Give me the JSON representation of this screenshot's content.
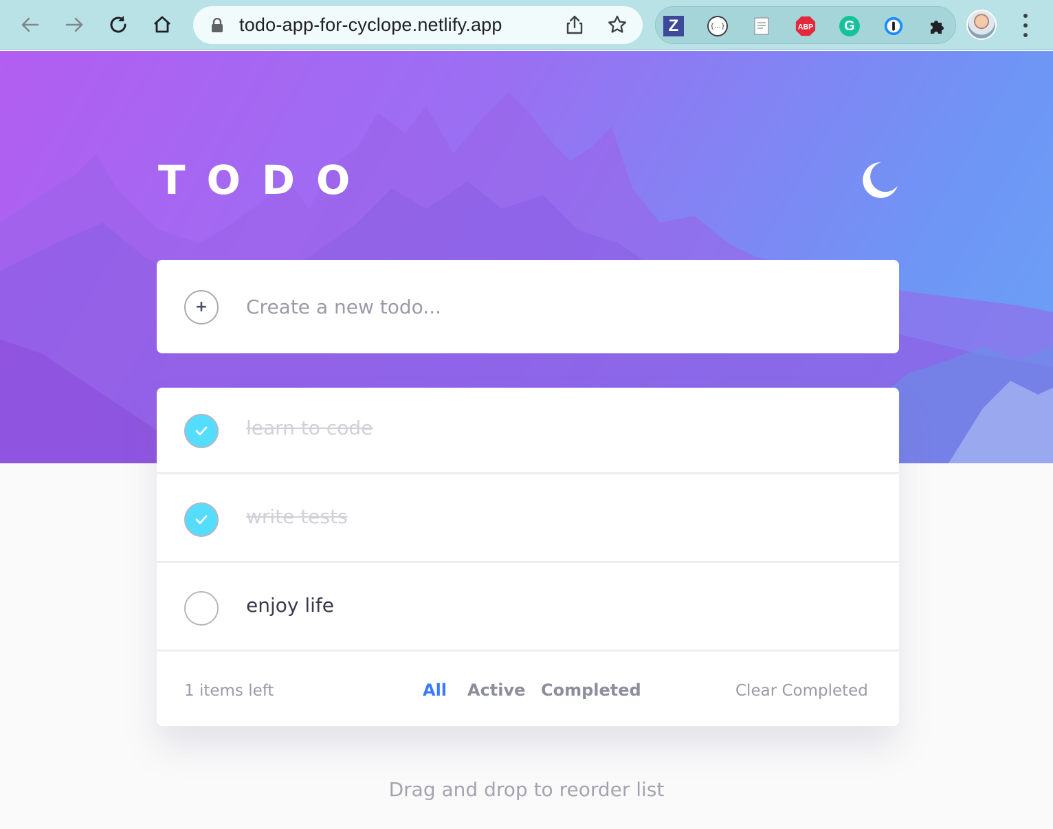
{
  "browser": {
    "url": "todo-app-for-cyclope.netlify.app",
    "extensions": [
      "zotero-icon",
      "json-viewer-icon",
      "page-icon",
      "adblock-plus-icon",
      "grammarly-icon",
      "1password-icon",
      "puzzle-icon"
    ],
    "ext_labels": {
      "zotero": "Z",
      "json": "{...}",
      "abp": "ABP",
      "grammarly": "G"
    },
    "colors": {
      "chrome_bg": "#b8e2e5",
      "abp": "#e2283a",
      "grammarly": "#15c39a",
      "onepassword": "#1a8cff",
      "zotero": "#3d4a9a"
    }
  },
  "app": {
    "title": "TODO",
    "theme_toggle_icon": "moon-icon",
    "new_todo": {
      "placeholder": "Create a new todo..."
    },
    "todos": [
      {
        "text": "learn to code",
        "completed": true
      },
      {
        "text": "write tests",
        "completed": true
      },
      {
        "text": "enjoy life",
        "completed": false
      }
    ],
    "footer": {
      "items_left": "1 items left",
      "filters": [
        "All",
        "Active",
        "Completed"
      ],
      "active_filter": "All",
      "clear_label": "Clear Completed"
    },
    "hint": "Drag and drop to reorder list",
    "colors": {
      "accent": "#3a7bfd",
      "check": "#55ddff",
      "gradient_start": "#b25ef0",
      "gradient_end": "#6aa2f6"
    }
  }
}
